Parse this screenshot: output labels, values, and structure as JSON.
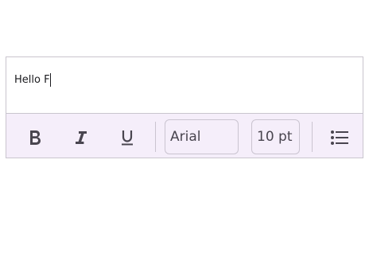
{
  "editor": {
    "text": "Hello F"
  },
  "toolbar": {
    "font_family": "Arial",
    "font_size": "10 pt"
  },
  "icons": [
    "bold-icon",
    "italic-icon",
    "underline-icon",
    "bulleted-list-icon"
  ]
}
